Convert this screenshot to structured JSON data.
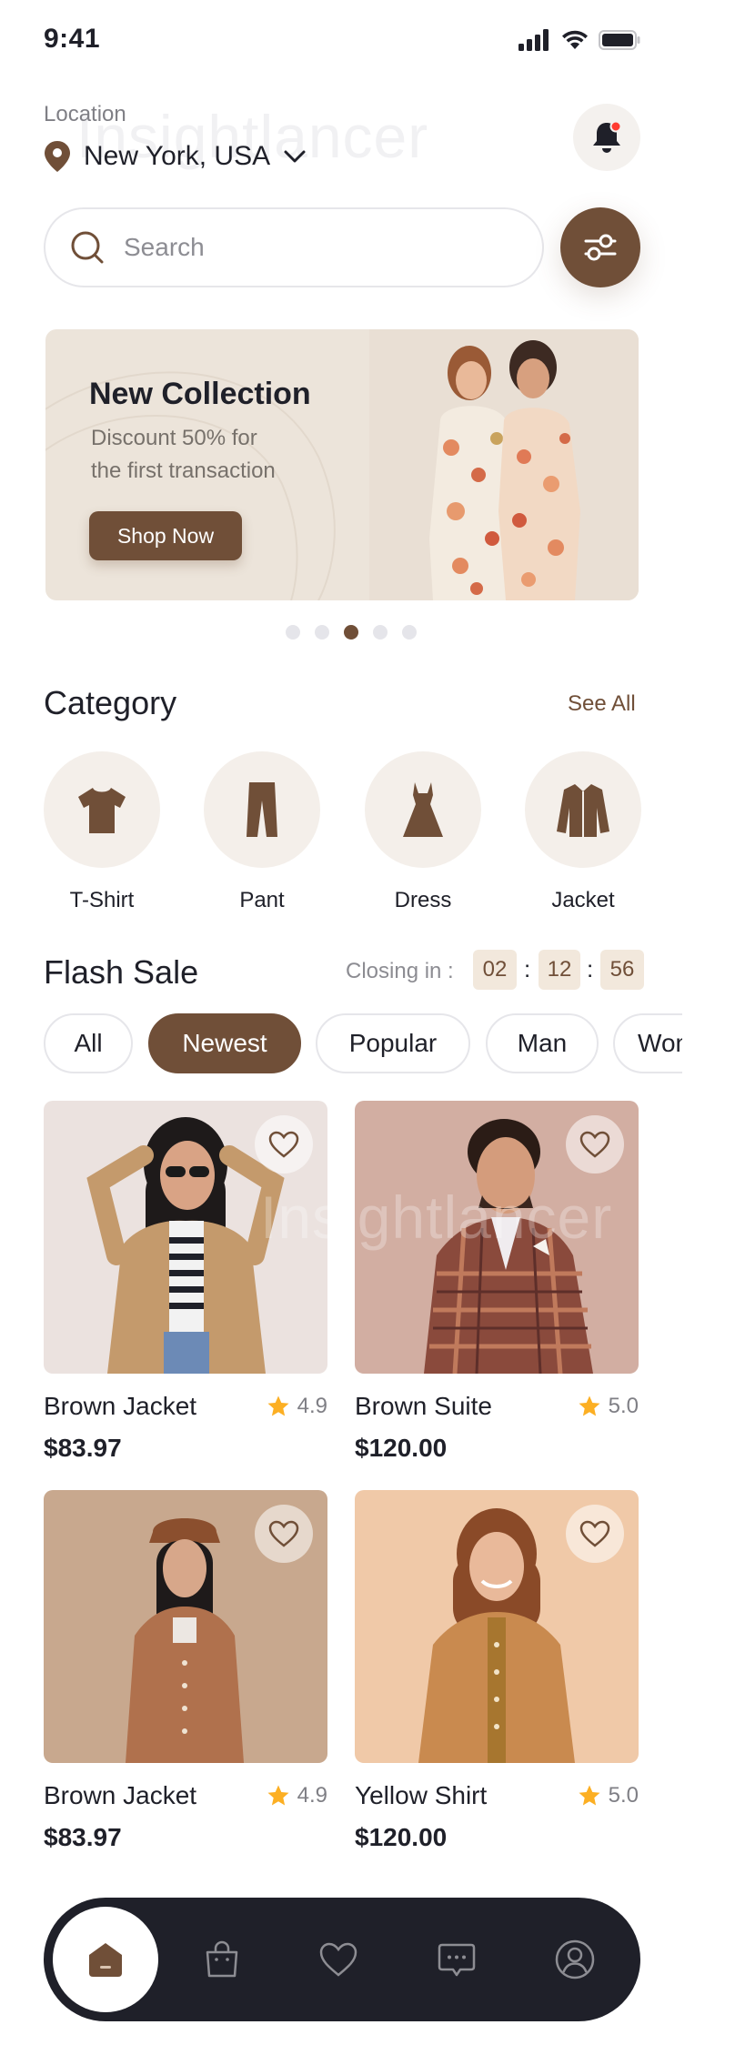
{
  "status": {
    "time": "9:41"
  },
  "header": {
    "location_label": "Location",
    "location_value": "New York, USA",
    "watermark": "Insightlancer"
  },
  "search": {
    "placeholder": "Search"
  },
  "banner": {
    "title": "New Collection",
    "subtitle_line1": "Discount 50% for",
    "subtitle_line2": "the first transaction",
    "button": "Shop Now",
    "pages": 5,
    "active_page": 3
  },
  "category": {
    "title": "Category",
    "see_all": "See All",
    "items": [
      {
        "label": "T-Shirt",
        "icon": "tshirt-icon"
      },
      {
        "label": "Pant",
        "icon": "pant-icon"
      },
      {
        "label": "Dress",
        "icon": "dress-icon"
      },
      {
        "label": "Jacket",
        "icon": "jacket-icon"
      }
    ]
  },
  "flash_sale": {
    "title": "Flash Sale",
    "closing_label": "Closing in :",
    "timer": {
      "hours": "02",
      "minutes": "12",
      "seconds": "56"
    },
    "filters": [
      "All",
      "Newest",
      "Popular",
      "Man",
      "Woman"
    ],
    "active_filter": "Newest"
  },
  "products": [
    {
      "name": "Brown Jacket",
      "rating": "4.9",
      "price": "$83.97"
    },
    {
      "name": "Brown Suite",
      "rating": "5.0",
      "price": "$120.00"
    },
    {
      "name": "Brown Jacket",
      "rating": "4.9",
      "price": "$83.97"
    },
    {
      "name": "Yellow Shirt",
      "rating": "5.0",
      "price": "$120.00"
    }
  ],
  "nav": {
    "items": [
      "home-icon",
      "bag-icon",
      "heart-icon",
      "chat-icon",
      "profile-icon"
    ],
    "active": "home-icon"
  },
  "colors": {
    "brand": "#704f38",
    "dark": "#1f2029",
    "star": "#fcaf23",
    "notification_dot": "#ff3b30"
  }
}
